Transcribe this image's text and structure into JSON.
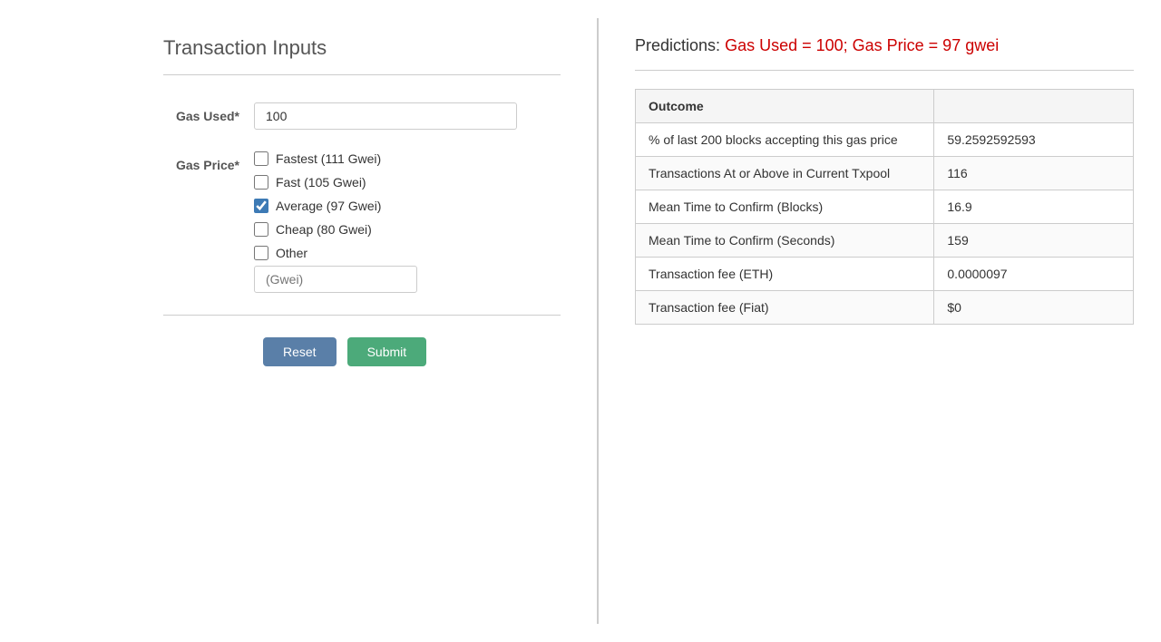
{
  "left_panel": {
    "title": "Transaction Inputs",
    "gas_used_label": "Gas Used*",
    "gas_used_value": "100",
    "gas_price_label": "Gas Price*",
    "checkboxes": [
      {
        "id": "fastest",
        "label": "Fastest (111 Gwei)",
        "checked": false
      },
      {
        "id": "fast",
        "label": "Fast (105 Gwei)",
        "checked": false
      },
      {
        "id": "average",
        "label": "Average (97 Gwei)",
        "checked": true
      },
      {
        "id": "cheap",
        "label": "Cheap (80 Gwei)",
        "checked": false
      },
      {
        "id": "other",
        "label": "Other",
        "checked": false
      }
    ],
    "other_placeholder": "(Gwei)",
    "reset_label": "Reset",
    "submit_label": "Submit"
  },
  "right_panel": {
    "predictions_prefix": "Predictions:",
    "predictions_values": "Gas Used = 100; Gas Price = 97 gwei",
    "table": {
      "header_outcome": "Outcome",
      "header_value": "",
      "rows": [
        {
          "outcome": "% of last 200 blocks accepting this gas price",
          "value": "59.2592592593"
        },
        {
          "outcome": "Transactions At or Above in Current Txpool",
          "value": "116"
        },
        {
          "outcome": "Mean Time to Confirm (Blocks)",
          "value": "16.9"
        },
        {
          "outcome": "Mean Time to Confirm (Seconds)",
          "value": "159"
        },
        {
          "outcome": "Transaction fee (ETH)",
          "value": "0.0000097"
        },
        {
          "outcome": "Transaction fee (Fiat)",
          "value": "$0"
        }
      ]
    }
  }
}
